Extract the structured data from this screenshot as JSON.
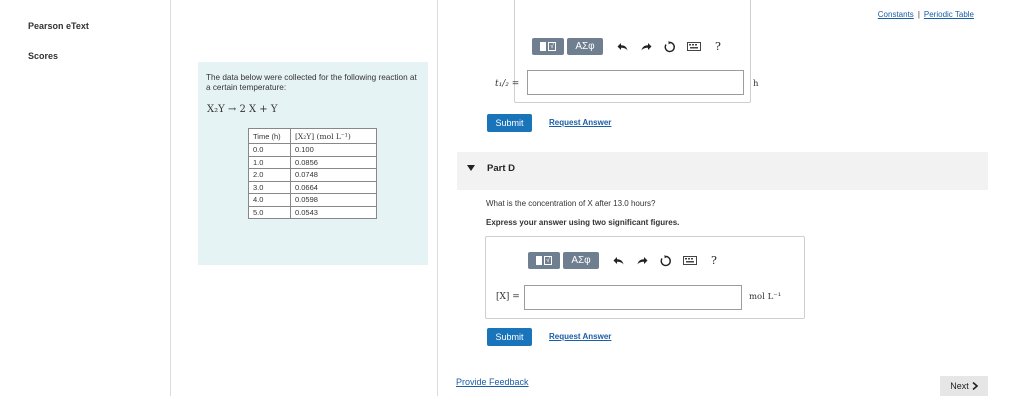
{
  "sidebar": {
    "items": [
      {
        "label": "Pearson eText"
      },
      {
        "label": "Scores"
      }
    ]
  },
  "problem": {
    "intro": "The data below were collected for the following reaction at a certain temperature:",
    "reaction": "X₂Y → 2 X + Y",
    "table": {
      "headers": [
        "Time (h)",
        "[X₂Y] (mol L⁻¹)"
      ],
      "rows": [
        [
          "0.0",
          "0.100"
        ],
        [
          "1.0",
          "0.0856"
        ],
        [
          "2.0",
          "0.0748"
        ],
        [
          "3.0",
          "0.0664"
        ],
        [
          "4.0",
          "0.0598"
        ],
        [
          "5.0",
          "0.0543"
        ]
      ]
    }
  },
  "header_links": {
    "constants": "Constants",
    "separator": "|",
    "periodic_table": "Periodic Table"
  },
  "partC": {
    "toolbar": {
      "symbol_label": "ΑΣφ",
      "help_label": "?"
    },
    "input_label": "t₁/₂ =",
    "input_value": "",
    "unit": "h",
    "submit_label": "Submit",
    "request_label": "Request Answer"
  },
  "partD": {
    "title": "Part D",
    "question": "What is the concentration of X after 13.0 hours?",
    "instruction": "Express your answer using two significant figures.",
    "toolbar": {
      "symbol_label": "ΑΣφ",
      "help_label": "?"
    },
    "input_label": "[X] =",
    "input_value": "",
    "unit": "mol L⁻¹",
    "submit_label": "Submit",
    "request_label": "Request Answer"
  },
  "footer": {
    "feedback_label": "Provide Feedback",
    "next_label": "Next"
  },
  "colors": {
    "accent_blue": "#1a74b9",
    "link_blue": "#1a5ea6",
    "problem_bg": "#e6f3f5",
    "toolbar_gray": "#6f7f8f"
  }
}
